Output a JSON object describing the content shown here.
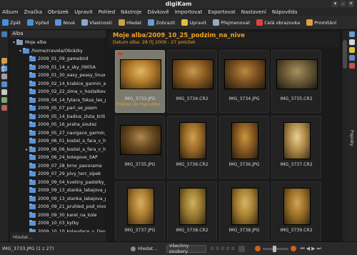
{
  "window": {
    "title": "digiKam",
    "buttons": [
      "▾",
      "–",
      "✕"
    ]
  },
  "menu": [
    "Album",
    "Značka",
    "Obrázek",
    "Upravit",
    "Pohled",
    "Nástroje",
    "Dávkově",
    "Importovat",
    "Exportovat",
    "Nastavení",
    "Nápověda"
  ],
  "toolbar": [
    {
      "label": "Zpět",
      "icon": "back-arrow-icon",
      "color": "#4a90d9"
    },
    {
      "label": "Vpřed",
      "icon": "forward-arrow-icon",
      "color": "#4a90d9"
    },
    {
      "label": "Nové",
      "icon": "new-album-icon",
      "color": "#5b94d8"
    },
    {
      "label": "Vlastnosti",
      "icon": "properties-icon",
      "color": "#8aa8cc"
    },
    {
      "label": "Hledat",
      "icon": "search-icon",
      "color": "#c8a050"
    },
    {
      "label": "Zobrazit",
      "icon": "view-icon",
      "color": "#6a9bd1"
    },
    {
      "label": "Upravit",
      "icon": "edit-icon",
      "color": "#e0c040"
    },
    {
      "label": "Přejmenovat",
      "icon": "rename-icon",
      "color": "#9ab"
    },
    {
      "label": "Celá obrazovka",
      "icon": "fullscreen-icon",
      "color": "#e04040"
    },
    {
      "label": "Promítání",
      "icon": "slideshow-icon",
      "color": "#e0a040"
    }
  ],
  "left_panel": {
    "header": "Alba",
    "tab_label": "Alba",
    "search_placeholder": "Hledat...",
    "tree": [
      {
        "label": "Moje alba",
        "level": 0,
        "expander": "▾"
      },
      {
        "label": "/home/rcevela/Obrázky",
        "level": 1,
        "expander": "▾"
      },
      {
        "label": "2009_01_09_gamebird",
        "level": 2,
        "expander": ""
      },
      {
        "label": "2009_01_14_x_sky_0905A",
        "level": 2,
        "expander": ""
      },
      {
        "label": "2009_01_30_easy_peasy_linux",
        "level": 2,
        "expander": ""
      },
      {
        "label": "2009_02_14_krabice_garmin_a_",
        "level": 2,
        "expander": ""
      },
      {
        "label": "2009_02_22_zima_v_hostalkove",
        "level": 2,
        "expander": ""
      },
      {
        "label": "2009_04_14_fytara_fokus_les_p",
        "level": 2,
        "expander": ""
      },
      {
        "label": "2009_05_07_pari_se_psem",
        "level": 2,
        "expander": ""
      },
      {
        "label": "2009_05_14_badius_zluta_kritik",
        "level": 2,
        "expander": ""
      },
      {
        "label": "2009_05_16_praha_soutez",
        "level": 2,
        "expander": ""
      },
      {
        "label": "2009_05_27_navigace_garmin_",
        "level": 2,
        "expander": ""
      },
      {
        "label": "2009_06_01_kostel_a_fara_v_hos",
        "level": 2,
        "expander": ""
      },
      {
        "label": "2009_06_06_kostel_a_fara_v_hos",
        "level": 2,
        "expander": "▸"
      },
      {
        "label": "2009_06_24_kolegove_SAP",
        "level": 2,
        "expander": ""
      },
      {
        "label": "2009_07_28_brno_panorama",
        "level": 2,
        "expander": ""
      },
      {
        "label": "2009_07_29_pivy_terc_sipek",
        "level": 2,
        "expander": ""
      },
      {
        "label": "2009_09_04_kvetiny_pastelky_p",
        "level": 2,
        "expander": ""
      },
      {
        "label": "2009_09_13_stanka_labajova_p",
        "level": 2,
        "expander": ""
      },
      {
        "label": "2009_09_13_stanka_labajova_p",
        "level": 2,
        "expander": ""
      },
      {
        "label": "2009_09_21_pruhled_pod_nivou",
        "level": 2,
        "expander": ""
      },
      {
        "label": "2009_09_30_karel_na_kole",
        "level": 2,
        "expander": ""
      },
      {
        "label": "2009_10_03_kytky",
        "level": 2,
        "expander": ""
      },
      {
        "label": "2009_10_10_kolaudace_u_Dan",
        "level": 2,
        "expander": ""
      }
    ]
  },
  "album": {
    "title": "Moje alba/2009_10_25_podzim_na_nive",
    "subtitle": "Datum alba: 28 říj 2009 - 27 položek"
  },
  "thumbnails": [
    {
      "name": "IMG_3733.JPG",
      "comment": "Průhled do Hajnušiho...",
      "selected": true,
      "orientation": "landscape",
      "palette": [
        "#b07a2a",
        "#3a2a12",
        "#e0b860"
      ]
    },
    {
      "name": "IMG_3734.CR2",
      "comment": "",
      "selected": false,
      "orientation": "landscape",
      "palette": [
        "#8a5a20",
        "#2a1e10",
        "#c89a50"
      ]
    },
    {
      "name": "IMG_3734.JPG",
      "comment": "",
      "selected": false,
      "orientation": "landscape",
      "palette": [
        "#7a5020",
        "#241a0e",
        "#b88a40"
      ]
    },
    {
      "name": "IMG_3735.CR2",
      "comment": "",
      "selected": false,
      "orientation": "landscape",
      "palette": [
        "#6a5a38",
        "#1e1a10",
        "#a89060"
      ]
    },
    {
      "name": "IMG_3735.JPG",
      "comment": "",
      "selected": false,
      "orientation": "landscape",
      "palette": [
        "#6a4a20",
        "#1e160c",
        "#b08850"
      ]
    },
    {
      "name": "IMG_3736.CR2",
      "comment": "",
      "selected": false,
      "orientation": "portrait",
      "palette": [
        "#9a6a28",
        "#2a1e10",
        "#d0a050"
      ]
    },
    {
      "name": "IMG_3736.JPG",
      "comment": "",
      "selected": false,
      "orientation": "portrait",
      "palette": [
        "#8a5a22",
        "#281c0e",
        "#c8983e"
      ]
    },
    {
      "name": "IMG_3737.CR2",
      "comment": "",
      "selected": false,
      "orientation": "portrait",
      "palette": [
        "#b08a48",
        "#3a3018",
        "#e8d098"
      ]
    },
    {
      "name": "IMG_3737.JPG",
      "comment": "",
      "selected": false,
      "orientation": "portrait",
      "palette": [
        "#a87a30",
        "#3a2a12",
        "#d8b060"
      ]
    },
    {
      "name": "IMG_3738.CR2",
      "comment": "",
      "selected": false,
      "orientation": "portrait",
      "palette": [
        "#9a7a30",
        "#322810",
        "#d0b060"
      ]
    },
    {
      "name": "IMG_3738.JPG",
      "comment": "",
      "selected": false,
      "orientation": "portrait",
      "palette": [
        "#a88032",
        "#382a12",
        "#d8b468"
      ]
    },
    {
      "name": "IMG_3739.CR2",
      "comment": "",
      "selected": false,
      "orientation": "portrait",
      "palette": [
        "#9a7028",
        "#322410",
        "#d0a458"
      ]
    }
  ],
  "right_panel": {
    "tab_label": "Popisky"
  },
  "status": {
    "selection": "IMG_3733.JPG (1 z 27)",
    "search_placeholder": "Hledat...",
    "filter": "Všechny soubory",
    "rating_stars": 5,
    "rating_value": 0
  }
}
